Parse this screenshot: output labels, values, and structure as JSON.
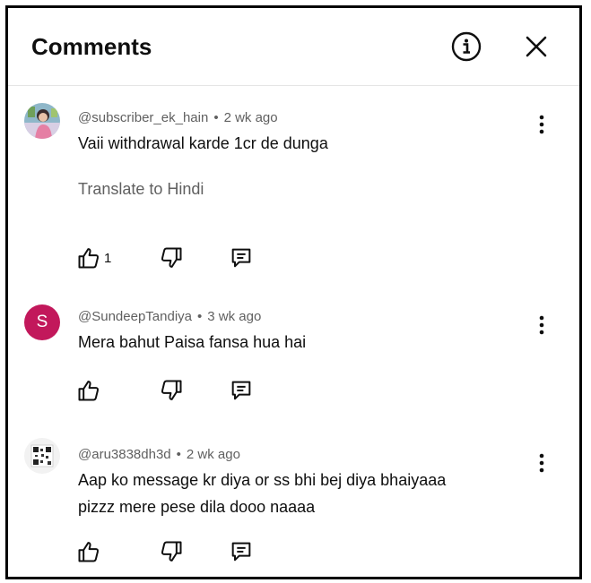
{
  "header": {
    "title": "Comments",
    "info_icon": "info-icon",
    "close_icon": "close-icon"
  },
  "comments": [
    {
      "handle": "@subscriber_ek_hain",
      "time": "2 wk ago",
      "avatar": "avatar-image",
      "text": "Vaii withdrawal karde 1cr de dunga",
      "translate": "Translate to Hindi",
      "likes": "1"
    },
    {
      "handle": "@SundeepTandiya",
      "time": "3 wk ago",
      "avatar_letter": "S",
      "avatar_color": "#c2185b",
      "text": "Mera bahut Paisa fansa hua hai"
    },
    {
      "handle": "@aru3838dh3d",
      "time": "2 wk ago",
      "avatar": "avatar-qr-image",
      "text_line1": "Aap ko message kr diya or ss bhi bej diya bhaiyaaa",
      "text_line2": "pizzz mere pese dila dooo naaaa"
    }
  ],
  "meta_separator": "•"
}
